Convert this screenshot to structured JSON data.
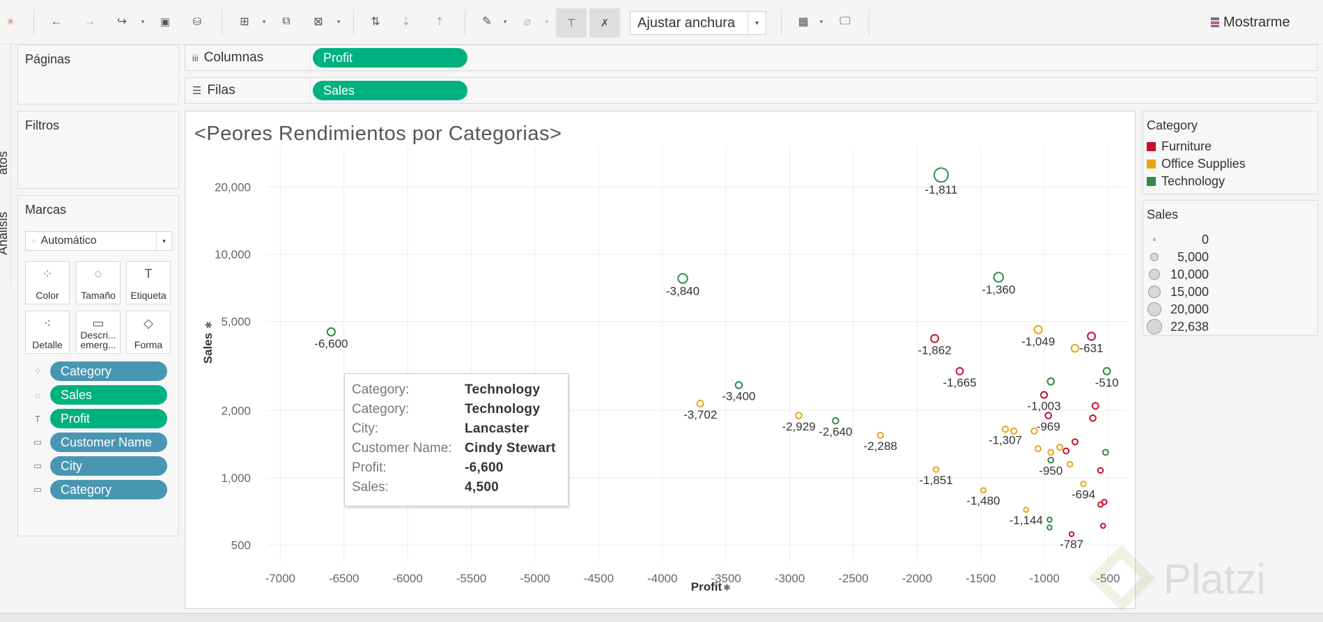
{
  "toolbar": {
    "fit_label": "Ajustar anchura",
    "show_me_label": "Mostrarme"
  },
  "side_tabs": {
    "data": "Datos",
    "analysis": "Análisis"
  },
  "panels": {
    "pages": "Páginas",
    "filters": "Filtros",
    "marks": "Marcas"
  },
  "shelves": {
    "columns_label": "Columnas",
    "columns_pill": "Profit",
    "rows_label": "Filas",
    "rows_pill": "Sales"
  },
  "marks": {
    "type_label": "Automático",
    "buttons": [
      {
        "label": "Color",
        "icon": "color-dots-icon"
      },
      {
        "label": "Tamaño",
        "icon": "size-icon"
      },
      {
        "label": "Etiqueta",
        "icon": "label-icon"
      },
      {
        "label": "Detalle",
        "icon": "detail-icon"
      },
      {
        "label": "Descri...\nemerg...",
        "icon": "tooltip-icon"
      },
      {
        "label": "Forma",
        "icon": "shape-icon"
      }
    ],
    "fields": [
      {
        "label": "Category",
        "kind": "dimension",
        "icon": "color-dots-icon"
      },
      {
        "label": "Sales",
        "kind": "measure",
        "icon": "size-icon"
      },
      {
        "label": "Profit",
        "kind": "measure",
        "icon": "label-icon"
      },
      {
        "label": "Customer Name",
        "kind": "dimension",
        "icon": "tooltip-icon"
      },
      {
        "label": "City",
        "kind": "dimension",
        "icon": "tooltip-icon"
      },
      {
        "label": "Category",
        "kind": "dimension",
        "icon": "tooltip-icon"
      }
    ]
  },
  "legend_category": {
    "title": "Category",
    "items": [
      {
        "label": "Furniture",
        "color": "#c8102e"
      },
      {
        "label": "Office Supplies",
        "color": "#e8a317"
      },
      {
        "label": "Technology",
        "color": "#2e8b47"
      }
    ]
  },
  "legend_sales": {
    "title": "Sales",
    "items": [
      {
        "label": "0",
        "value": 0
      },
      {
        "label": "5,000",
        "value": 5000
      },
      {
        "label": "10,000",
        "value": 10000
      },
      {
        "label": "15,000",
        "value": 15000
      },
      {
        "label": "20,000",
        "value": 20000
      },
      {
        "label": "22,638",
        "value": 22638
      }
    ]
  },
  "tooltip": {
    "rows": [
      {
        "key": "Category:",
        "value": "Technology"
      },
      {
        "key": "Category:",
        "value": "Technology"
      },
      {
        "key": "City:",
        "value": "Lancaster"
      },
      {
        "key": "Customer Name:",
        "value": "Cindy Stewart"
      },
      {
        "key": "Profit:",
        "value": "-6,600"
      },
      {
        "key": "Sales:",
        "value": "4,500"
      }
    ]
  },
  "watermark": "Platzi",
  "chart_data": {
    "type": "scatter",
    "title": "<Peores Rendimientos por Categorias>",
    "xlabel": "Profit",
    "ylabel": "Sales",
    "x_scale": "linear",
    "y_scale": "log",
    "xlim": [
      -7100,
      -350
    ],
    "ylim": [
      420,
      30000
    ],
    "x_ticks": [
      -7000,
      -6500,
      -6000,
      -5500,
      -5000,
      -4500,
      -4000,
      -3500,
      -3000,
      -2500,
      -2000,
      -1500,
      -1000,
      -500
    ],
    "x_tick_labels": [
      "-7000",
      "-6500",
      "-6000",
      "-5500",
      "-5000",
      "-4500",
      "-4000",
      "-3500",
      "-3000",
      "-2500",
      "-2000",
      "-1500",
      "-1000",
      "-500"
    ],
    "y_ticks": [
      500,
      1000,
      2000,
      5000,
      10000,
      20000
    ],
    "y_tick_labels": [
      "500",
      "1,000",
      "2,000",
      "5,000",
      "10,000",
      "20,000"
    ],
    "grid": true,
    "legend": "right",
    "series": [
      {
        "name": "Furniture",
        "color": "#c8102e",
        "points": [
          {
            "x": -1862,
            "y": 4200,
            "label": "-1,862"
          },
          {
            "x": -1665,
            "y": 3000,
            "label": "-1,665"
          },
          {
            "x": -631,
            "y": 4300,
            "label": "-631"
          },
          {
            "x": -1003,
            "y": 2350,
            "label": "-1,003"
          },
          {
            "x": -969,
            "y": 1900,
            "label": "-969"
          },
          {
            "x": -600,
            "y": 2100,
            "label": ""
          },
          {
            "x": -620,
            "y": 1850,
            "label": ""
          },
          {
            "x": -760,
            "y": 1450,
            "label": ""
          },
          {
            "x": -830,
            "y": 1320,
            "label": ""
          },
          {
            "x": -560,
            "y": 1080,
            "label": ""
          },
          {
            "x": -560,
            "y": 760,
            "label": ""
          },
          {
            "x": -530,
            "y": 780,
            "label": ""
          },
          {
            "x": -540,
            "y": 610,
            "label": ""
          },
          {
            "x": -787,
            "y": 560,
            "label": "-787"
          }
        ]
      },
      {
        "name": "Office Supplies",
        "color": "#e8a317",
        "points": [
          {
            "x": -3702,
            "y": 2150,
            "label": "-3,702"
          },
          {
            "x": -2929,
            "y": 1900,
            "label": "-2,929"
          },
          {
            "x": -2288,
            "y": 1550,
            "label": "-2,288"
          },
          {
            "x": -1851,
            "y": 1090,
            "label": "-1,851"
          },
          {
            "x": -1480,
            "y": 880,
            "label": "-1,480"
          },
          {
            "x": -1307,
            "y": 1650,
            "label": "-1,307"
          },
          {
            "x": -1240,
            "y": 1620,
            "label": ""
          },
          {
            "x": -1049,
            "y": 4600,
            "label": "-1,049"
          },
          {
            "x": -760,
            "y": 3800,
            "label": ""
          },
          {
            "x": -1080,
            "y": 1620,
            "label": ""
          },
          {
            "x": -1050,
            "y": 1350,
            "label": ""
          },
          {
            "x": -950,
            "y": 1300,
            "label": ""
          },
          {
            "x": -880,
            "y": 1370,
            "label": ""
          },
          {
            "x": -800,
            "y": 1150,
            "label": ""
          },
          {
            "x": -694,
            "y": 940,
            "label": "-694"
          },
          {
            "x": -1144,
            "y": 720,
            "label": "-1,144"
          }
        ]
      },
      {
        "name": "Technology",
        "color": "#2e8b47",
        "points": [
          {
            "x": -6600,
            "y": 4500,
            "label": "-6,600"
          },
          {
            "x": -3840,
            "y": 7800,
            "label": "-3,840"
          },
          {
            "x": -3400,
            "y": 2600,
            "label": "-3,400"
          },
          {
            "x": -2640,
            "y": 1800,
            "label": "-2,640"
          },
          {
            "x": -1811,
            "y": 22638,
            "label": "-1,811"
          },
          {
            "x": -1360,
            "y": 7900,
            "label": "-1,360"
          },
          {
            "x": -510,
            "y": 3000,
            "label": "-510"
          },
          {
            "x": -950,
            "y": 2700,
            "label": ""
          },
          {
            "x": -950,
            "y": 1200,
            "label": "-950"
          },
          {
            "x": -520,
            "y": 1300,
            "label": ""
          },
          {
            "x": -960,
            "y": 650,
            "label": ""
          },
          {
            "x": -960,
            "y": 600,
            "label": ""
          }
        ]
      }
    ]
  }
}
